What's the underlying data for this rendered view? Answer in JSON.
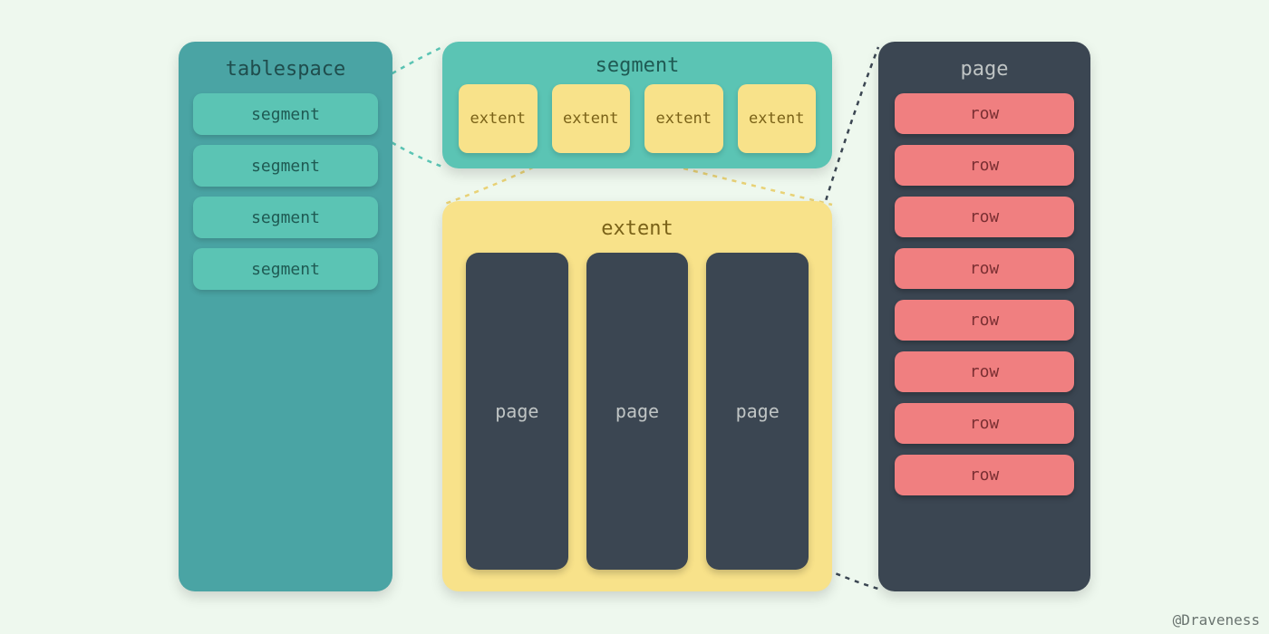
{
  "tablespace": {
    "title": "tablespace",
    "items": [
      "segment",
      "segment",
      "segment",
      "segment"
    ]
  },
  "segment": {
    "title": "segment",
    "extents": [
      "extent",
      "extent",
      "extent",
      "extent"
    ]
  },
  "extent": {
    "title": "extent",
    "pages": [
      "page",
      "page",
      "page"
    ]
  },
  "page": {
    "title": "page",
    "rows": [
      "row",
      "row",
      "row",
      "row",
      "row",
      "row",
      "row",
      "row"
    ]
  },
  "credit": "@Draveness",
  "colors": {
    "background": "#eef8ee",
    "tablespace_bg": "#4aa4a4",
    "segment_bg": "#5bc4b4",
    "extent_bg": "#f8e28a",
    "page_bg": "#3b4652",
    "row_bg": "#f07f80",
    "conn_teal": "#5bc4b4",
    "conn_yellow": "#e9d276",
    "conn_dark": "#3b4652"
  }
}
